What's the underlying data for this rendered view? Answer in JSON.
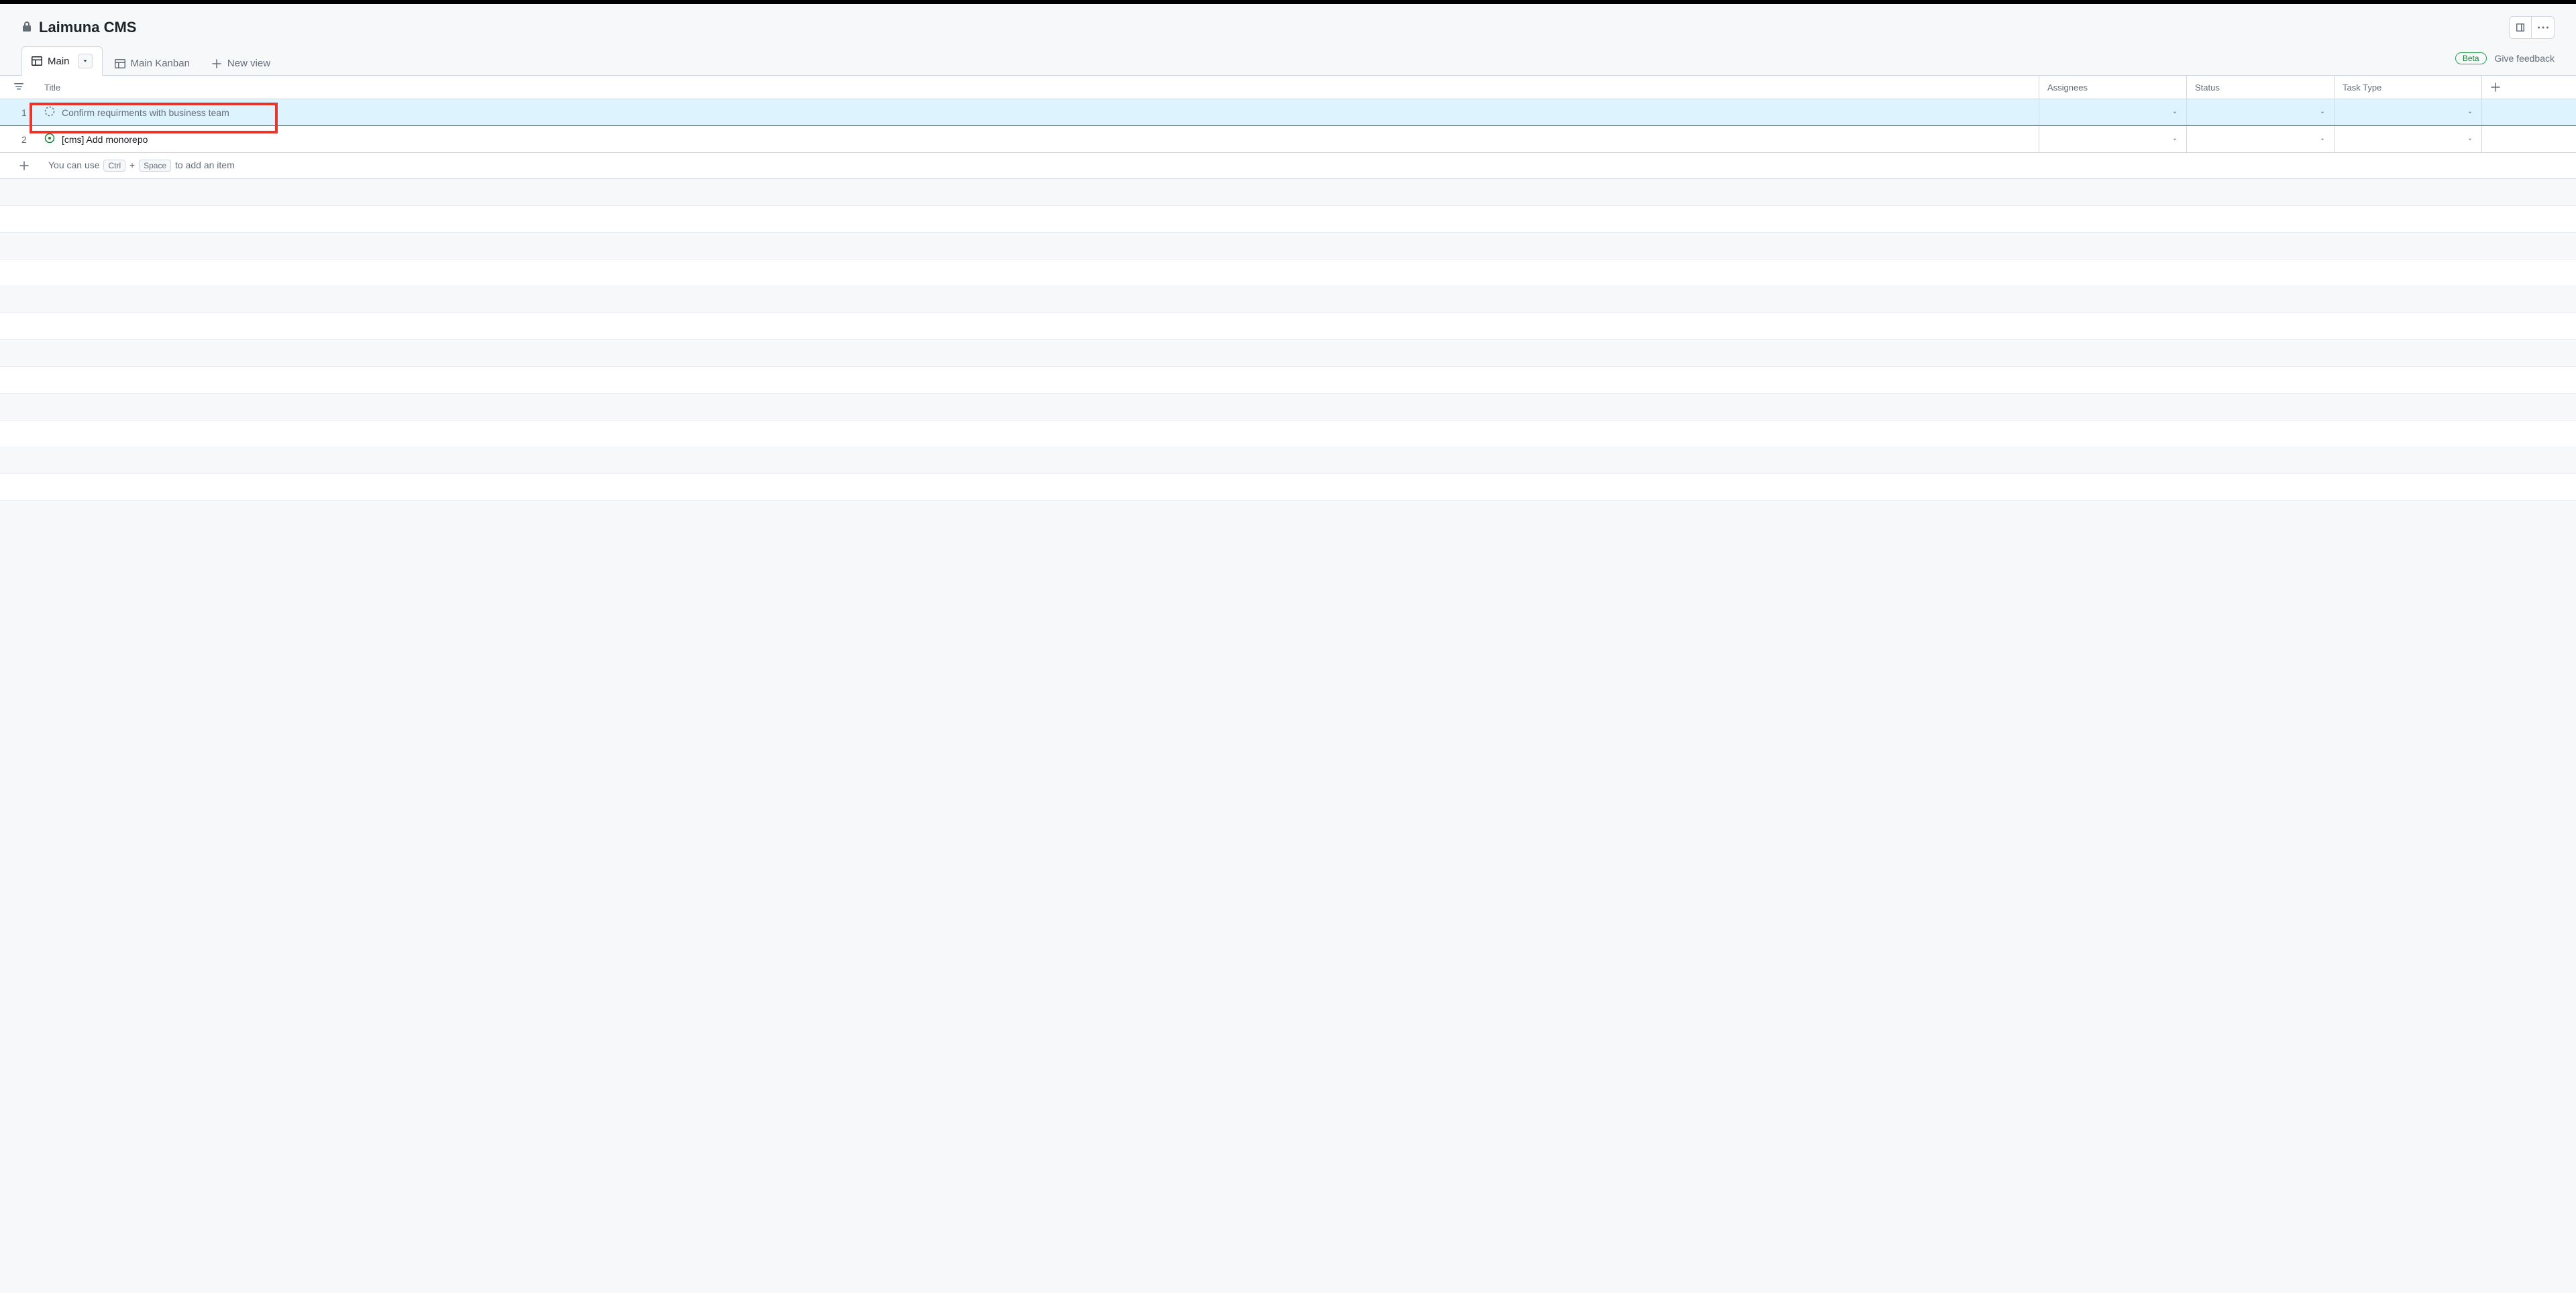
{
  "header": {
    "title": "Laimuna CMS"
  },
  "tabs": {
    "main": "Main",
    "kanban": "Main Kanban",
    "new_view": "New view"
  },
  "badges": {
    "beta": "Beta",
    "feedback": "Give feedback"
  },
  "columns": {
    "title": "Title",
    "assignees": "Assignees",
    "status": "Status",
    "task_type": "Task Type"
  },
  "rows": [
    {
      "num": "1",
      "title": "Confirm requirments with business team",
      "icon": "draft",
      "selected": true,
      "highlighted": true
    },
    {
      "num": "2",
      "title": "[cms] Add monorepo",
      "icon": "open",
      "selected": false,
      "highlighted": false
    }
  ],
  "add_hint": {
    "prefix": "You can use",
    "key1": "Ctrl",
    "sep": "+",
    "key2": "Space",
    "suffix": "to add an item"
  }
}
